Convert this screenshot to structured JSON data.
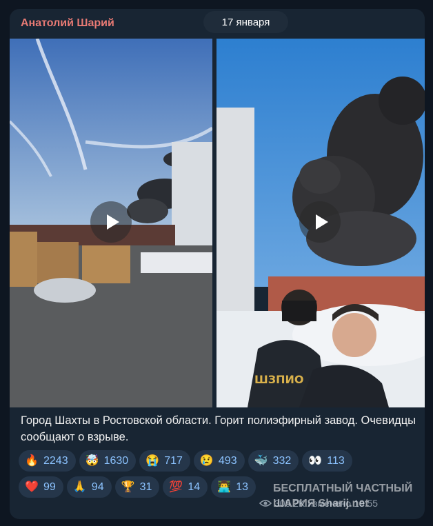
{
  "post": {
    "author": "Анатолий Шарий",
    "date_badge": "17 января",
    "caption": "Город Шахты в Ростовской области. Горит полиэфирный завод. Очевидцы сообщают о взрыве.",
    "views": "305.2K",
    "edited_label": "изменено",
    "time": "19:55"
  },
  "watermark": {
    "line1": "БЕСПЛАТНЫЙ ЧАСТНЫЙ",
    "line2": "ШАРИЯ Sharij.net"
  },
  "colors": {
    "author_name": "#e87a74",
    "reaction_count": "#8cc3ff",
    "bubble_bg": "#182533",
    "app_bg": "#0e1621"
  },
  "reactions": {
    "row1": [
      {
        "icon": "fire",
        "count": "2243"
      },
      {
        "icon": "exploding-head",
        "count": "1630"
      },
      {
        "icon": "crying-face",
        "count": "717"
      },
      {
        "icon": "sad-face",
        "count": "493"
      },
      {
        "icon": "whale",
        "count": "332"
      },
      {
        "icon": "eyes",
        "count": "113"
      }
    ],
    "row2": [
      {
        "icon": "red-heart",
        "count": "99"
      },
      {
        "icon": "praying-hands",
        "count": "94"
      },
      {
        "icon": "trophy",
        "count": "31"
      },
      {
        "icon": "hundred-points",
        "count": "14"
      },
      {
        "icon": "man-technologist",
        "count": "13"
      }
    ]
  }
}
